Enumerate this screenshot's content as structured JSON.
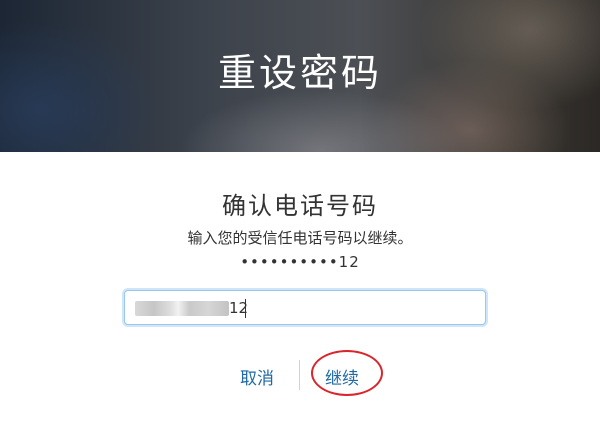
{
  "header": {
    "title": "重设密码"
  },
  "panel": {
    "title": "确认电话号码",
    "description": "输入您的受信任电话号码以继续。",
    "masked_phone": "••••••••••12"
  },
  "phone_field": {
    "visible_value": "12"
  },
  "actions": {
    "cancel_label": "取消",
    "continue_label": "继续"
  },
  "colors": {
    "link": "#1f6aa5",
    "field_border": "#9ac7ee",
    "highlight_ring": "#d8262c"
  }
}
